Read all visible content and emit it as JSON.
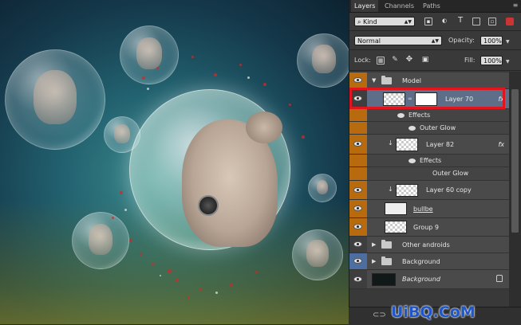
{
  "panel": {
    "tabs": [
      {
        "label": "Layers",
        "active": true
      },
      {
        "label": "Channels",
        "active": false
      },
      {
        "label": "Paths",
        "active": false
      }
    ],
    "filter": {
      "label": "Kind"
    },
    "blend_mode": "Normal",
    "opacity": {
      "label": "Opacity:",
      "value": "100%"
    },
    "lock": {
      "label": "Lock:"
    },
    "fill": {
      "label": "Fill:",
      "value": "100%"
    }
  },
  "layers": {
    "model_group": "Model",
    "layer70": "Layer 70",
    "layer70_effects": "Effects",
    "layer70_outer_glow": "Outer Glow",
    "layer82": "Layer 82",
    "layer82_effects": "Effects",
    "layer82_outer_glow": "Outer Glow",
    "layer60copy": "Layer 60 copy",
    "bulbe": "bullbe",
    "group9": "Group 9",
    "other_androids": "Other androids",
    "background_group": "Background",
    "background": "Background",
    "fx": "fx"
  },
  "colors": {
    "orange_tag": "#b86a0f",
    "blue_tag": "#4c6ea0",
    "selection": "#e0151d",
    "watermark": "#1e57c9"
  },
  "watermark": "UiBQ.CoM"
}
